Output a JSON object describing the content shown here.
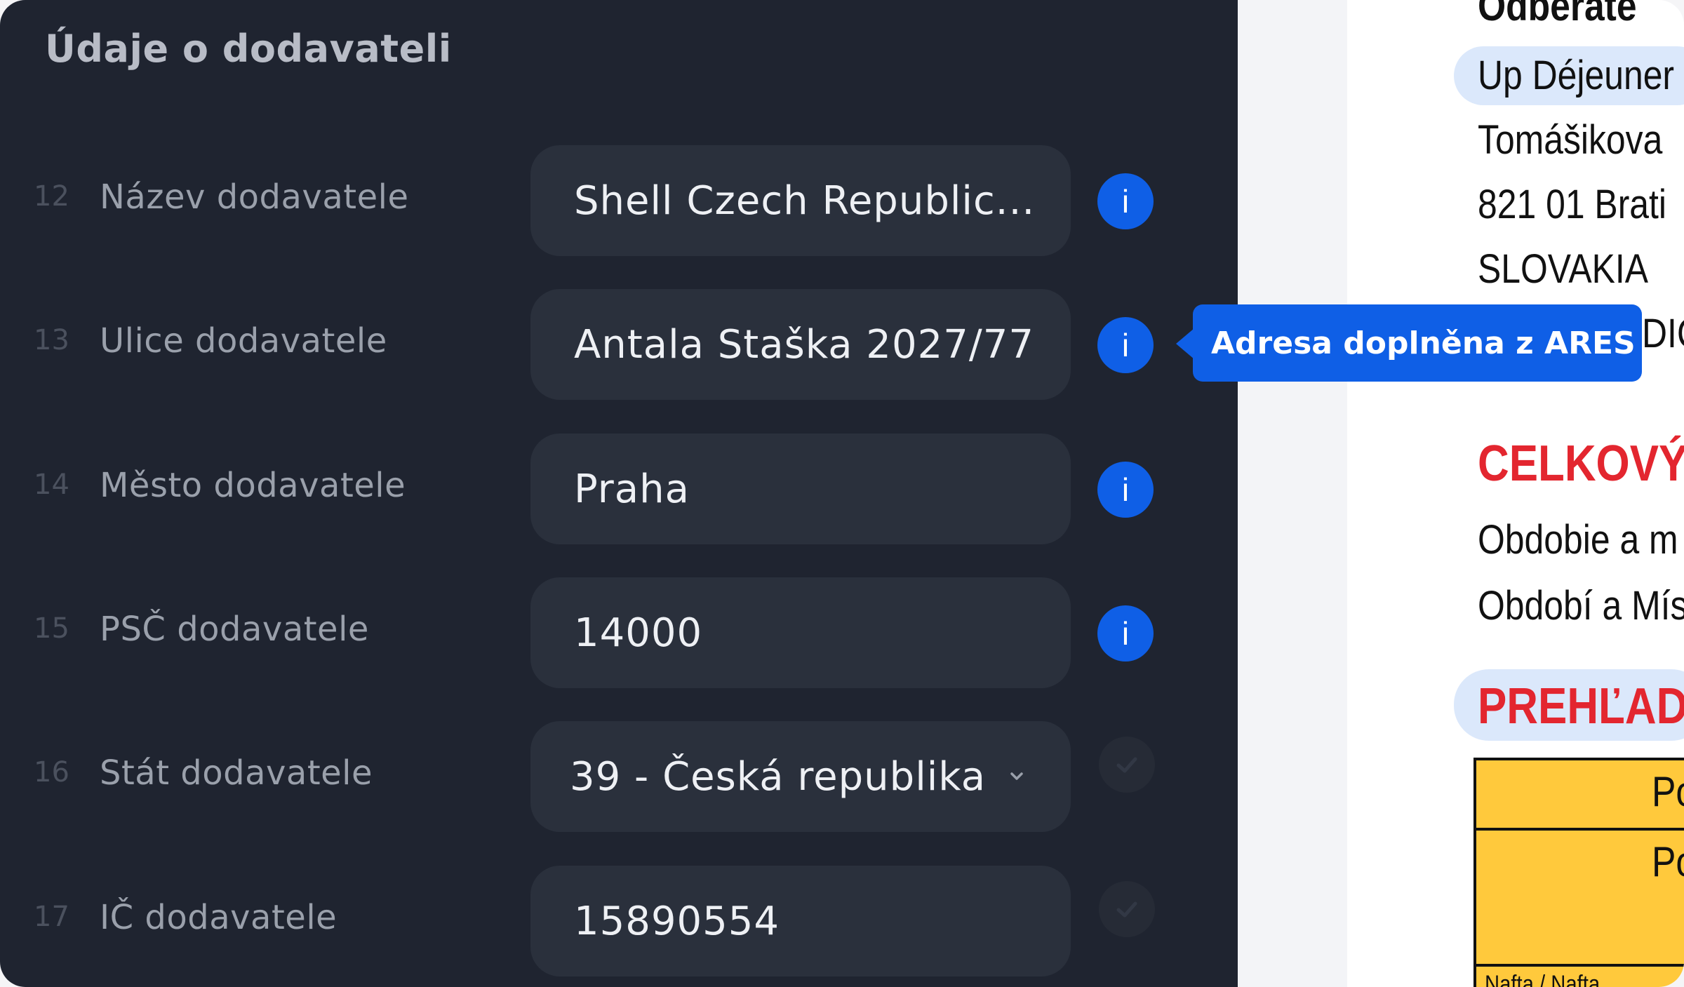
{
  "panel": {
    "title": "Údaje o dodavateli",
    "rows": [
      {
        "num": "12",
        "label": "Název dodavatele",
        "value": "Shell Czech Republic...",
        "status": "info"
      },
      {
        "num": "13",
        "label": "Ulice dodavatele",
        "value": "Antala Staška 2027/77",
        "status": "info"
      },
      {
        "num": "14",
        "label": "Město dodavatele",
        "value": "Praha",
        "status": "info"
      },
      {
        "num": "15",
        "label": "PSČ dodavatele",
        "value": "14000",
        "status": "info"
      },
      {
        "num": "16",
        "label": "Stát dodavatele",
        "value": "39 - Česká republika",
        "status": "check"
      },
      {
        "num": "17",
        "label": "IČ dodavatele",
        "value": "15890554",
        "status": "check"
      }
    ],
    "info_glyph": "i",
    "icons": {
      "info": "info-icon",
      "check": "check-icon",
      "dropdown": "chevron-down-icon"
    }
  },
  "tooltip": {
    "text": "Adresa doplněna z ARES"
  },
  "document": {
    "heading_partial": "Odberate",
    "company": "Up Déjeuner",
    "street": "Tomášikova",
    "city": "821 01 Brati",
    "country": "SLOVAKIA",
    "tax_partial": "DIČ",
    "total_heading": "CELKOVÝ",
    "period_sk": "Obdobie a m",
    "period_cz": "Období a Mís",
    "overview_heading": "PREHĽAD",
    "table_cell_1": "Po",
    "table_cell_2": "Po",
    "table_footer": "Nafta / Nafta"
  },
  "colors": {
    "panel_bg": "#1f2430",
    "field_bg": "#2a303c",
    "accent_blue": "#0f5fe6",
    "doc_red": "#e3262f",
    "table_yellow": "#ffc93c",
    "pill_blue": "#dbe8fb"
  }
}
